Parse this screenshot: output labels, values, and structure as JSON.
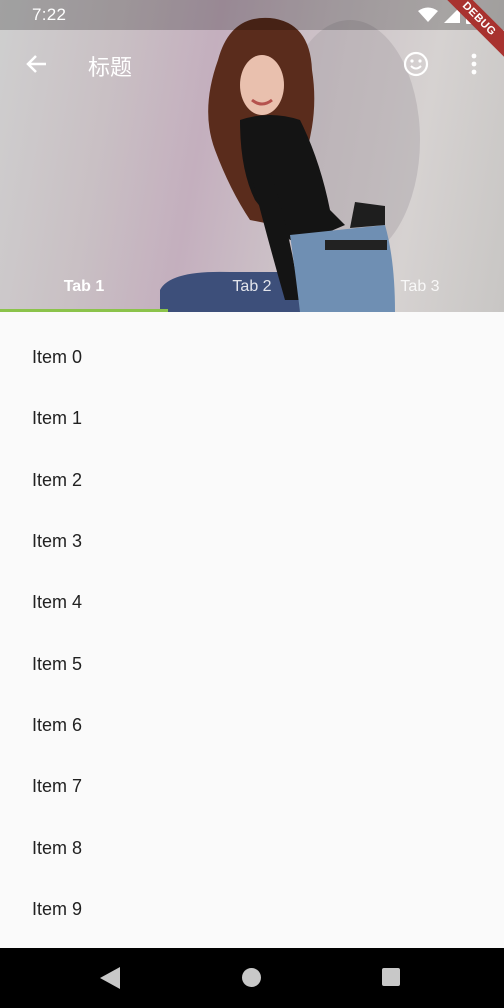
{
  "status_bar": {
    "time": "7:22",
    "debug_label": "DEBUG"
  },
  "app_bar": {
    "title": "标题",
    "back_icon": "arrow-back-icon",
    "emoji_icon": "smiley-icon",
    "menu_icon": "more-vert-icon"
  },
  "tabs": [
    {
      "label": "Tab 1",
      "selected": true
    },
    {
      "label": "Tab 2",
      "selected": false
    },
    {
      "label": "Tab 3",
      "selected": false
    }
  ],
  "colors": {
    "indicator": "#8bc34a",
    "debug_ribbon": "#a8322f",
    "list_background": "#fafafa"
  },
  "list": {
    "items": [
      "Item 0",
      "Item 1",
      "Item 2",
      "Item 3",
      "Item 4",
      "Item 5",
      "Item 6",
      "Item 7",
      "Item 8",
      "Item 9"
    ]
  },
  "nav_bar": {
    "back_icon": "triangle-back-icon",
    "home_icon": "circle-home-icon",
    "recents_icon": "square-recents-icon"
  }
}
